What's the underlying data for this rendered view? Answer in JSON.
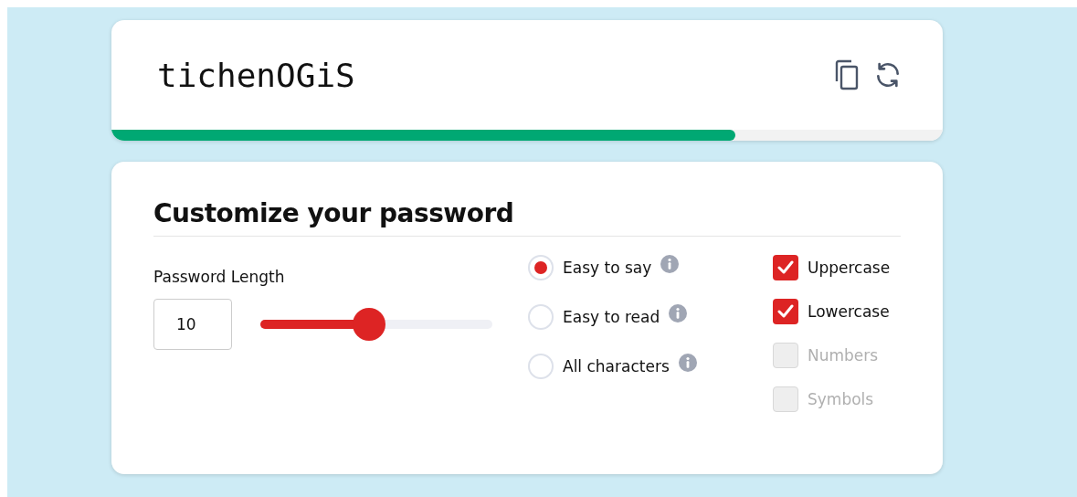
{
  "password": {
    "value": "tichenOGiS",
    "strength": {
      "level": 0.75
    }
  },
  "customize": {
    "title": "Customize your password",
    "length": {
      "label": "Password Length",
      "value": "10",
      "level": 0.47
    },
    "modes": [
      {
        "label": "Easy to say",
        "selected": true
      },
      {
        "label": "Easy to read",
        "selected": false
      },
      {
        "label": "All characters",
        "selected": false
      }
    ],
    "options": [
      {
        "label": "Uppercase",
        "checked": true,
        "disabled": false
      },
      {
        "label": "Lowercase",
        "checked": true,
        "disabled": false
      },
      {
        "label": "Numbers",
        "checked": false,
        "disabled": true
      },
      {
        "label": "Symbols",
        "checked": false,
        "disabled": true
      }
    ]
  }
}
